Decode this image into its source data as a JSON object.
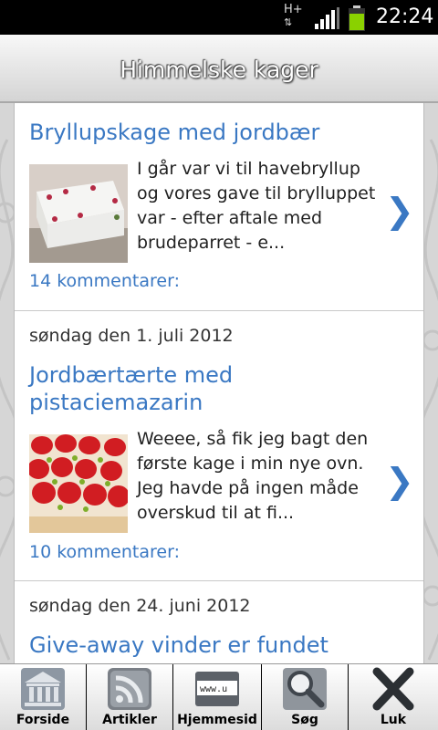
{
  "status_bar": {
    "network": "H+",
    "time": "22:24"
  },
  "header": {
    "title": "Himmelske kager"
  },
  "posts": [
    {
      "title": "Bryllupskage med jordbær",
      "excerpt": "I går var vi til havebryllup og vores gave til brylluppet var - efter aftale med brudeparret - e...",
      "comments": "14 kommentarer:"
    },
    {
      "date": "søndag den 1. juli 2012",
      "title": "Jordbærtærte med pistaciemazarin",
      "excerpt": "Weeee, så fik jeg bagt den første kage i min nye ovn. Jeg havde på ingen måde overskud til at fi...",
      "comments": "10 kommentarer:"
    },
    {
      "date": "søndag den 24. juni 2012",
      "title": "Give-away vinder er fundet"
    }
  ],
  "tabs": [
    {
      "label": "Forside",
      "icon": "bank-building-icon"
    },
    {
      "label": "Artikler",
      "icon": "rss-feed-icon"
    },
    {
      "label": "Hjemmesid",
      "icon": "www-icon",
      "icon_text": "www.u"
    },
    {
      "label": "Søg",
      "icon": "magnifier-icon"
    },
    {
      "label": "Luk",
      "icon": "close-x-icon"
    }
  ],
  "colors": {
    "link": "#3a78c3",
    "status_bar": "#000000",
    "battery": "#8ad100"
  }
}
